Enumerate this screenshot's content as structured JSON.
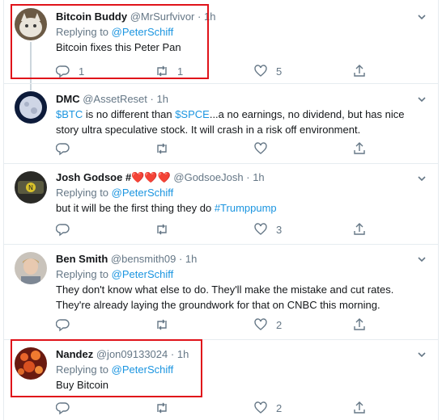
{
  "tweets": [
    {
      "name": "Bitcoin Buddy",
      "handle": "@MrSurfvivor",
      "time": "1h",
      "replying_label": "Replying to",
      "replying_to": "@PeterSchiff",
      "text": "Bitcoin fixes this Peter Pan",
      "reply_count": "1",
      "retweet_count": "1",
      "like_count": "5"
    },
    {
      "name": "DMC",
      "handle": "@AssetReset",
      "time": "1h",
      "text_parts": [
        "$BTC",
        " is no different than ",
        "$SPCE",
        "...a no earnings, no dividend, but has nice"
      ],
      "text_line2": "story ultra speculative stock. It will crash in a risk off environment."
    },
    {
      "name": "Josh Godsoe #",
      "hearts": "❤️❤️❤️",
      "handle": "@GodsoeJosh",
      "time": "1h",
      "replying_label": "Replying to",
      "replying_to": "@PeterSchiff",
      "text": "but it will be the first thing they do ",
      "hashtag": "#Trumppump",
      "like_count": "3"
    },
    {
      "name": "Ben Smith",
      "handle": "@bensmith09",
      "time": "1h",
      "replying_label": "Replying to",
      "replying_to": "@PeterSchiff",
      "text_line1": "They don't know what else to do. They'll make the mistake and cut rates.",
      "text_line2": "They're already laying the groundwork for that on CNBC this morning.",
      "like_count": "2"
    },
    {
      "name": "Nandez",
      "handle": "@jon09133024",
      "time": "1h",
      "replying_label": "Replying to",
      "replying_to": "@PeterSchiff",
      "text": "Buy Bitcoin",
      "like_count": "2"
    }
  ],
  "dot": "·",
  "colors": {
    "link": "#1b95e0",
    "muted": "#657786",
    "highlight": "#e0131a"
  }
}
